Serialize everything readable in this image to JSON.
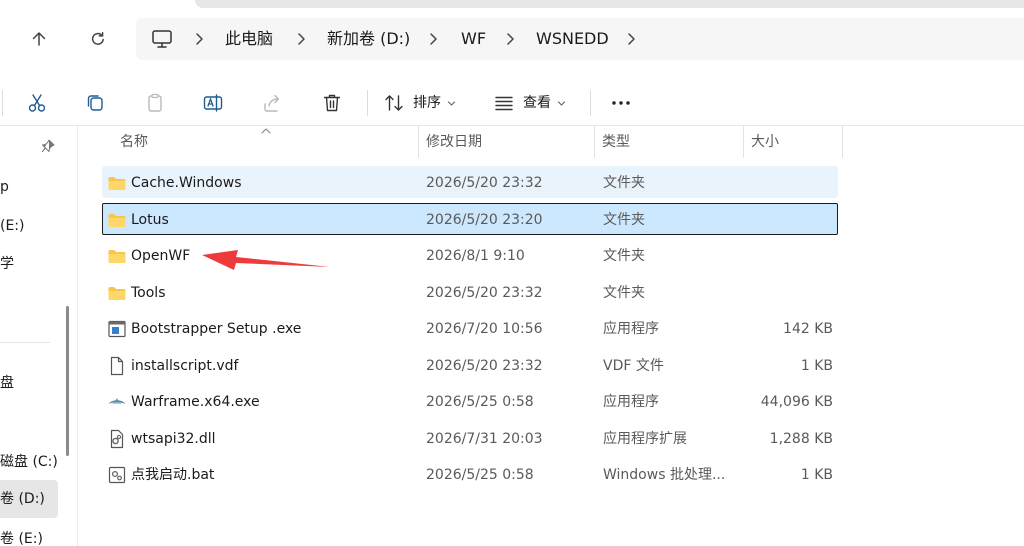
{
  "address": {
    "crumbs": [
      "此电脑",
      "新加卷 (D:)",
      "WF",
      "WSNEDD"
    ]
  },
  "toolbar": {
    "sort_label": "排序",
    "view_label": "查看"
  },
  "nav": {
    "items": [
      "p",
      "(E:)",
      "学",
      "盘",
      "磁盘 (C:)",
      "卷 (D:)",
      "卷 (E:)"
    ]
  },
  "columns": {
    "name": "名称",
    "date": "修改日期",
    "type": "类型",
    "size": "大小"
  },
  "files": [
    {
      "name": "Cache.Windows",
      "date": "2026/5/20 23:32",
      "type": "文件夹",
      "size": "",
      "icon": "folder-icon",
      "state": "hover"
    },
    {
      "name": "Lotus",
      "date": "2026/5/20 23:20",
      "type": "文件夹",
      "size": "",
      "icon": "folder-icon",
      "state": "selected"
    },
    {
      "name": "OpenWF",
      "date": "2026/8/1 9:10",
      "type": "文件夹",
      "size": "",
      "icon": "folder-icon",
      "state": ""
    },
    {
      "name": "Tools",
      "date": "2026/5/20 23:32",
      "type": "文件夹",
      "size": "",
      "icon": "folder-icon",
      "state": ""
    },
    {
      "name": "Bootstrapper Setup .exe",
      "date": "2026/7/20 10:56",
      "type": "应用程序",
      "size": "142 KB",
      "icon": "exe-window-icon",
      "state": ""
    },
    {
      "name": "installscript.vdf",
      "date": "2026/5/20 23:32",
      "type": "VDF 文件",
      "size": "1 KB",
      "icon": "file-icon",
      "state": ""
    },
    {
      "name": "Warframe.x64.exe",
      "date": "2026/5/25 0:58",
      "type": "应用程序",
      "size": "44,096 KB",
      "icon": "warframe-logo-icon",
      "state": ""
    },
    {
      "name": "wtsapi32.dll",
      "date": "2026/7/31 20:03",
      "type": "应用程序扩展",
      "size": "1,288 KB",
      "icon": "dll-gear-icon",
      "state": ""
    },
    {
      "name": "点我启动.bat",
      "date": "2026/5/25 0:58",
      "type": "Windows 批处理...",
      "size": "1 KB",
      "icon": "bat-gear-icon",
      "state": ""
    }
  ],
  "colors": {
    "selected_bg": "#cce8ff",
    "hover_bg": "#e9f3fb",
    "folder": "#f7c64b",
    "arrow": "#ee3a3a"
  }
}
